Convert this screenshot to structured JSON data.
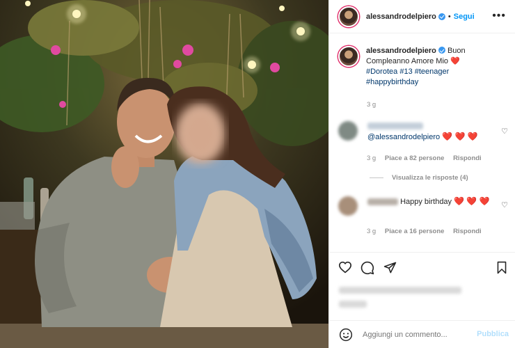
{
  "post": {
    "author": "alessandrodelpiero",
    "follow_label": "Segui",
    "more_label": "•••",
    "separator": "•"
  },
  "caption": {
    "author": "alessandrodelpiero",
    "text": "Buon Compleanno Amore Mio",
    "heart": "❤️",
    "tags": [
      "#Dorotea",
      "#13",
      "#teenager",
      "#happybirthday"
    ],
    "time": "3 g"
  },
  "comments": [
    {
      "mention": "@alessandrodelpiero",
      "text": "❤️ ❤️ ❤️",
      "time": "3 g",
      "likes": "Piace a 82 persone",
      "reply": "Rispondi"
    },
    {
      "text": "Happy birthday",
      "hearts": "❤️ ❤️ ❤️",
      "time": "3 g",
      "likes": "Piace a 16 persone",
      "reply": "Rispondi"
    }
  ],
  "view_replies": "Visualizza le risposte (4)",
  "add_comment": {
    "placeholder": "Aggiungi un commento...",
    "publish_label": "Pubblica"
  },
  "colors": {
    "link_blue": "#0095f6",
    "heart_red": "#e0245e",
    "hashtag": "#00376b",
    "muted": "#8e8e8e"
  }
}
